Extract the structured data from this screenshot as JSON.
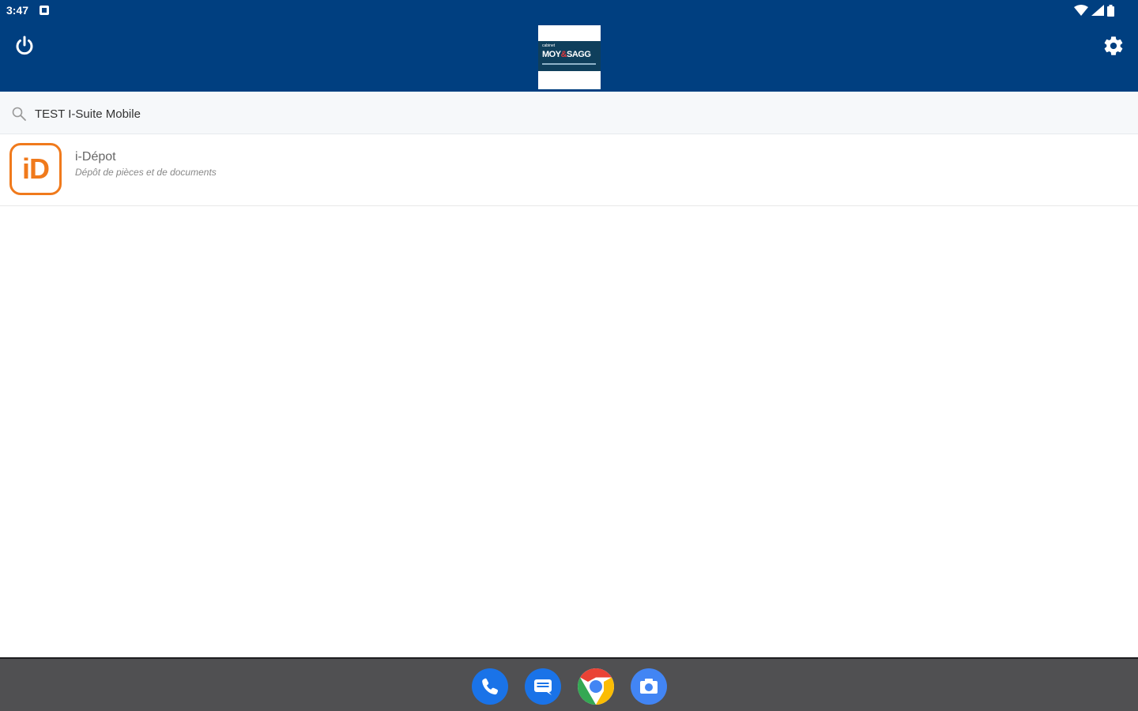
{
  "status_bar": {
    "time": "3:47"
  },
  "header": {
    "logo": {
      "small_text": "cabinet",
      "name_left": "MOY",
      "name_amp": "&",
      "name_right": "SAGG"
    }
  },
  "search": {
    "value": "TEST I-Suite Mobile"
  },
  "list": {
    "items": [
      {
        "icon_text": "iD",
        "title": "i-Dépot",
        "subtitle": "Dépôt de pièces et de documents"
      }
    ]
  },
  "dock": {
    "apps": [
      "phone-icon",
      "messages-icon",
      "chrome-icon",
      "camera-icon"
    ]
  },
  "colors": {
    "header_bg": "#003f80",
    "accent_orange": "#f07a1c",
    "dock_bg": "#505052"
  }
}
